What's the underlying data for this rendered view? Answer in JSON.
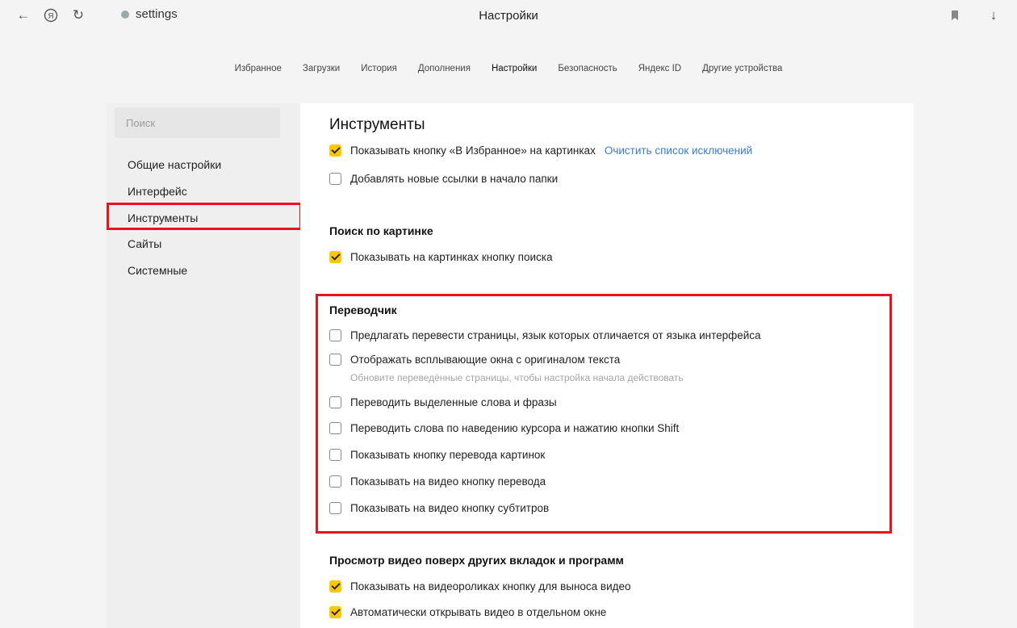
{
  "browser": {
    "address": "settings",
    "title": "Настройки"
  },
  "nav": {
    "tabs": [
      "Избранное",
      "Загрузки",
      "История",
      "Дополнения",
      "Настройки",
      "Безопасность",
      "Яндекс ID",
      "Другие устройства"
    ]
  },
  "sidebar": {
    "search_placeholder": "Поиск",
    "items": [
      "Общие настройки",
      "Интерфейс",
      "Инструменты",
      "Сайты",
      "Системные"
    ]
  },
  "sections": {
    "tools": {
      "title": "Инструменты",
      "opt1": "Показывать кнопку «В Избранное» на картинках",
      "opt1_link": "Очистить список исключений",
      "opt2": "Добавлять новые ссылки в начало папки"
    },
    "image_search": {
      "title": "Поиск по картинке",
      "opt1": "Показывать на картинках кнопку поиска"
    },
    "translator": {
      "title": "Переводчик",
      "opt1": "Предлагать перевести страницы, язык которых отличается от языка интерфейса",
      "opt2": "Отображать всплывающие окна с оригиналом текста",
      "hint": "Обновите переведённые страницы, чтобы настройка начала действовать",
      "opt3": "Переводить выделенные слова и фразы",
      "opt4": "Переводить слова по наведению курсора и нажатию кнопки Shift",
      "opt5": "Показывать кнопку перевода картинок",
      "opt6": "Показывать на видео кнопку перевода",
      "opt7": "Показывать на видео кнопку субтитров"
    },
    "video": {
      "title": "Просмотр видео поверх других вкладок и программ",
      "opt1": "Показывать на видеороликах кнопку для выноса видео",
      "opt2": "Автоматически открывать видео в отдельном окне"
    }
  },
  "icons": {
    "back": "back-arrow-icon",
    "yandex": "yandex-logo-icon",
    "reload": "reload-icon",
    "bookmark": "bookmark-icon",
    "download": "download-icon"
  },
  "colors": {
    "accent_check": "#ffc800",
    "link": "#3b7bd4",
    "highlight": "#e8141d"
  }
}
